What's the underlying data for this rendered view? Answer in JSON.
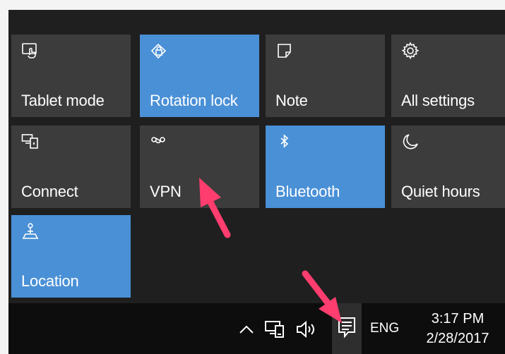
{
  "tiles": [
    {
      "label": "Tablet mode",
      "icon": "tablet-mode-icon",
      "active": false
    },
    {
      "label": "Rotation lock",
      "icon": "rotation-lock-icon",
      "active": true
    },
    {
      "label": "Note",
      "icon": "note-icon",
      "active": false
    },
    {
      "label": "All settings",
      "icon": "gear-icon",
      "active": false
    },
    {
      "label": "Connect",
      "icon": "connect-icon",
      "active": false
    },
    {
      "label": "VPN",
      "icon": "vpn-icon",
      "active": false
    },
    {
      "label": "Bluetooth",
      "icon": "bluetooth-icon",
      "active": true
    },
    {
      "label": "Quiet hours",
      "icon": "moon-icon",
      "active": false
    },
    {
      "label": "Location",
      "icon": "location-icon",
      "active": true
    }
  ],
  "taskbar": {
    "language": "ENG",
    "time": "3:17 PM",
    "date": "2/28/2017"
  },
  "colors": {
    "active_tile": "#4a90d6",
    "inactive_tile": "#3c3c3c",
    "panel": "#1f1f1f",
    "taskbar": "#0d0d0d",
    "annotation_arrow": "#ff3d6e"
  }
}
